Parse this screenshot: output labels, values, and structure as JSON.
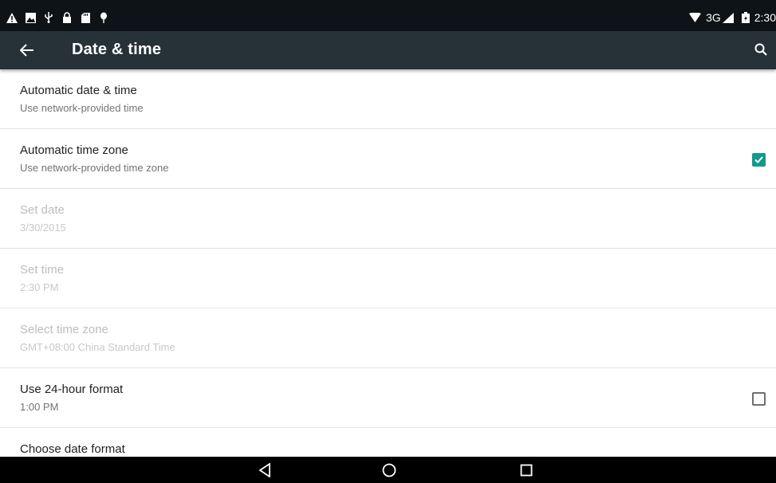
{
  "status_bar": {
    "left_icons": [
      "warning-icon",
      "image-icon",
      "usb-icon",
      "lock-icon",
      "sd-card-icon",
      "debug-icon"
    ],
    "network": "3G",
    "time": "2:30",
    "icons": [
      "wifi-icon",
      "signal-icon",
      "battery-icon"
    ]
  },
  "toolbar": {
    "title": "Date & time",
    "back_icon": "arrow-left-icon",
    "search_icon": "search-icon",
    "background": "#263238"
  },
  "settings": [
    {
      "title": "Automatic date & time",
      "summary": "Use network-provided time",
      "enabled": true,
      "checkbox": null
    },
    {
      "title": "Automatic time zone",
      "summary": "Use network-provided time zone",
      "enabled": true,
      "checkbox": true
    },
    {
      "title": "Set date",
      "summary": "3/30/2015",
      "enabled": false,
      "checkbox": null
    },
    {
      "title": "Set time",
      "summary": "2:30 PM",
      "enabled": false,
      "checkbox": null
    },
    {
      "title": "Select time zone",
      "summary": "GMT+08:00 China Standard Time",
      "enabled": false,
      "checkbox": null
    },
    {
      "title": "Use 24-hour format",
      "summary": "1:00 PM",
      "enabled": true,
      "checkbox": false
    },
    {
      "title": "Choose date format",
      "summary": "",
      "enabled": true,
      "checkbox": null
    }
  ],
  "colors": {
    "accent": "#129a8b",
    "status_bar": "#0d1317",
    "nav_bar": "#000000"
  },
  "nav_bar": {
    "buttons": [
      "back-triangle-icon",
      "home-circle-icon",
      "recents-square-icon"
    ]
  }
}
